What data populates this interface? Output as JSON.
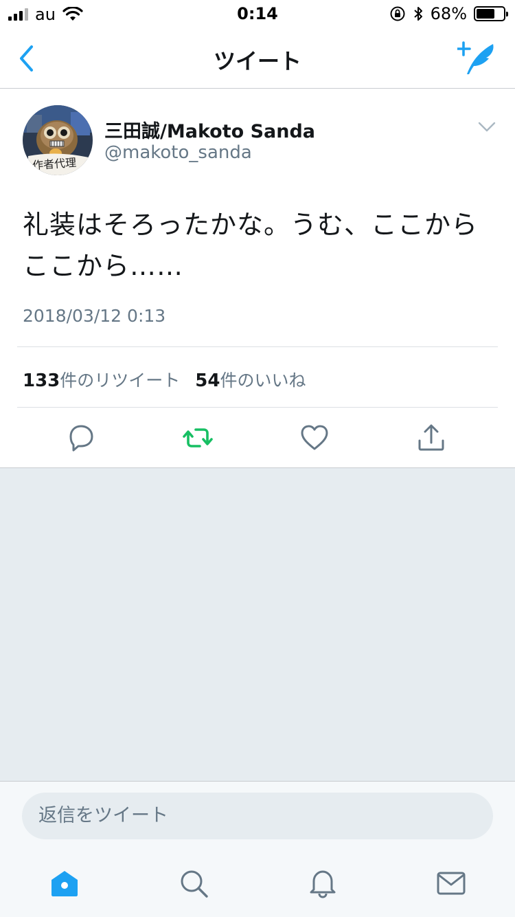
{
  "status_bar": {
    "carrier": "au",
    "time": "0:14",
    "battery_pct": "68%",
    "battery_level": 0.68
  },
  "nav": {
    "title": "ツイート",
    "back_icon": "chevron-left-icon",
    "compose_icon": "compose-tweet-icon"
  },
  "tweet": {
    "author_name": "三田誠/Makoto Sanda",
    "author_handle": "@makoto_sanda",
    "avatar_caption": "作者代理",
    "text": "礼装はそろったかな。うむ、ここからここから……",
    "timestamp": "2018/03/12 0:13",
    "retweet_count": "133",
    "retweet_label": "件のリツイート",
    "like_count": "54",
    "like_label": "件のいいね",
    "actions": [
      "reply-icon",
      "retweet-icon",
      "like-icon",
      "share-icon"
    ]
  },
  "reply": {
    "placeholder": "返信をツイート"
  },
  "tabs": [
    "home-icon",
    "search-icon",
    "notifications-icon",
    "messages-icon"
  ],
  "colors": {
    "accent": "#1da1f2",
    "retweet_active": "#17bf63",
    "secondary_text": "#657786",
    "background_grey": "#e6ecf0"
  }
}
